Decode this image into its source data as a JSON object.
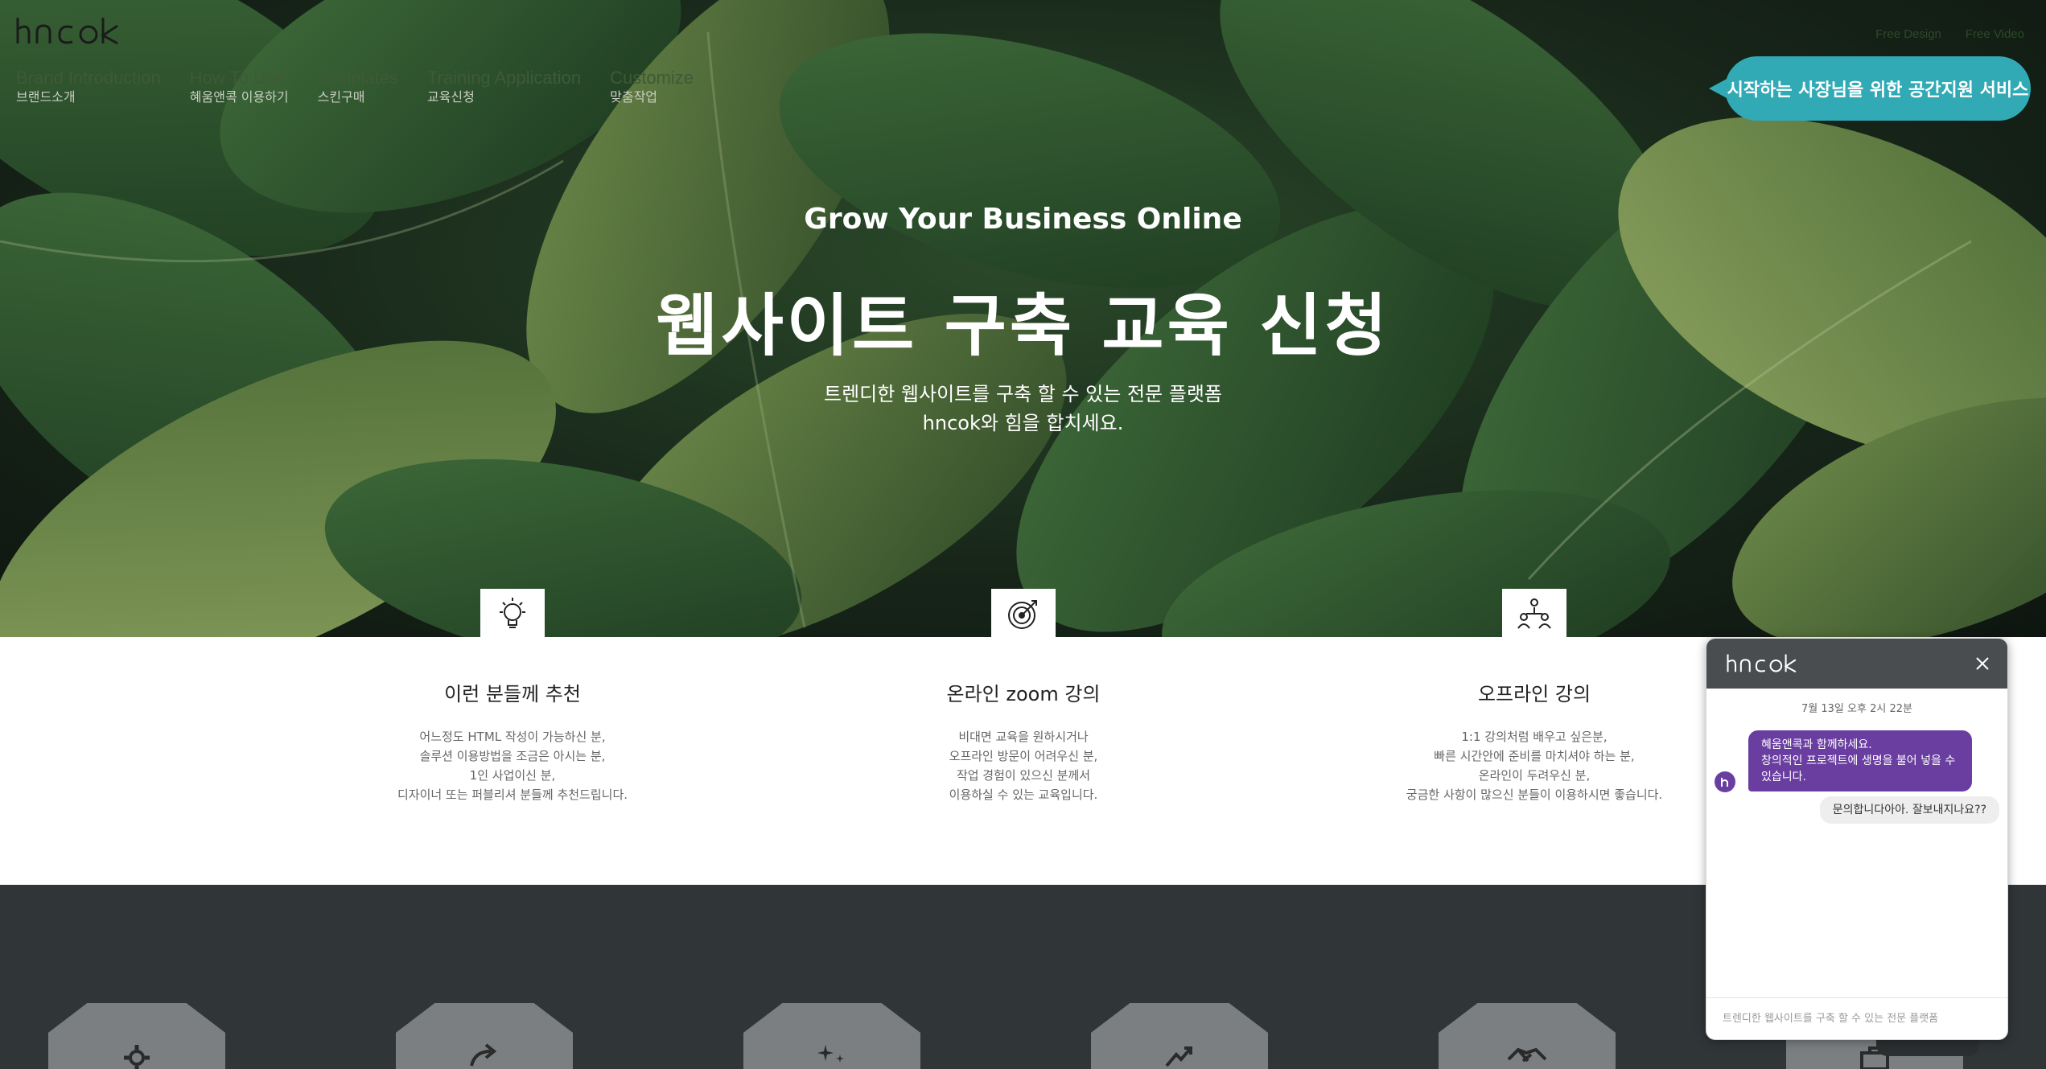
{
  "header": {
    "logo_text": "hncok",
    "nav": [
      {
        "en": "Brand Introduction",
        "ko": "브랜드소개"
      },
      {
        "en": "How To Use",
        "ko": "혜움앤콕 이용하기"
      },
      {
        "en": "Templates",
        "ko": "스킨구매"
      },
      {
        "en": "Training Application",
        "ko": "교육신청"
      },
      {
        "en": "Customize",
        "ko": "맞춤작업"
      }
    ],
    "top_links": [
      "Free Design",
      "Free Video"
    ],
    "promo_text": "시작하는 사장님을 위한 공간지원 서비스"
  },
  "hero": {
    "subtitle": "Grow Your Business Online",
    "title": "웹사이트 구축 교육 신청",
    "desc_line1": "트렌디한 웹사이트를 구축 할 수 있는 전문 플랫폼",
    "desc_line2": "hncok와 힘을 합치세요."
  },
  "features": [
    {
      "icon": "lightbulb-icon",
      "title": "이런 분들께 추천",
      "lines": [
        "어느정도 HTML 작성이 가능하신 분,",
        "솔루션 이용방법을 조금은 아시는 분,",
        "1인 사업이신 분,",
        "디자이너 또는 퍼블리셔 분들께 추천드립니다."
      ]
    },
    {
      "icon": "target-icon",
      "title": "온라인 zoom 강의",
      "lines": [
        "비대면 교육을 원하시거나",
        "오프라인 방문이 어려우신 분,",
        "작업 경험이 있으신 분께서",
        "이용하실 수 있는 교육입니다."
      ]
    },
    {
      "icon": "people-icon",
      "title": "오프라인 강의",
      "lines": [
        "1:1 강의처럼 배우고 싶은분,",
        "빠른 시간안에 준비를 마치셔야 하는 분,",
        "온라인이 두려우신 분,",
        "궁금한 사항이 많으신 분들이 이용하시면 좋습니다."
      ]
    }
  ],
  "services": [
    {
      "icon": "gear-icon"
    },
    {
      "icon": "share-arrow-icon"
    },
    {
      "icon": "sparkle-icon"
    },
    {
      "icon": "growth-arrow-icon"
    },
    {
      "icon": "handshake-icon"
    },
    {
      "icon": "briefcase-icon"
    }
  ],
  "chat": {
    "brand": "hncok",
    "timestamp": "7월 13일 오후 2시 22분",
    "incoming_line1": "혜움앤콕과 함께하세요.",
    "incoming_line2": "창의적인 프로젝트에 생명을 불어 넣을 수 있습니다.",
    "outgoing": "문의합니다아아. 잘보내지나요??",
    "input_placeholder": "트렌디한 웹사이트를 구축 할 수 있는 전문 플랫폼"
  },
  "colors": {
    "promo": "#32aab5",
    "chat_header": "#4a4d50",
    "chat_bubble": "#6a3ea0",
    "dark_section": "#303538"
  }
}
